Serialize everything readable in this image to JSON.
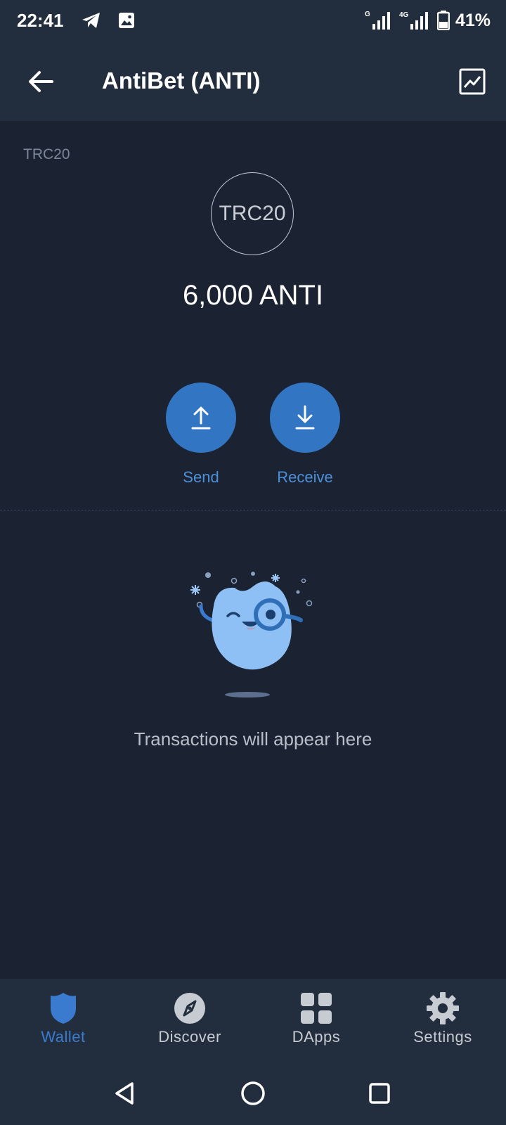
{
  "status_bar": {
    "time": "22:41",
    "battery": "41%",
    "left_icons": [
      "telegram-icon",
      "image-icon"
    ],
    "right_icons": [
      "signal-g-icon",
      "signal-4g-icon",
      "battery-icon"
    ],
    "network_labels": [
      "G",
      "4G"
    ]
  },
  "header": {
    "title": "AntiBet (ANTI)",
    "back_icon": "arrow-left-icon",
    "chart_icon": "price-chart-icon"
  },
  "token": {
    "network": "TRC20",
    "logo_text": "TRC20",
    "balance": "6,000 ANTI"
  },
  "actions": {
    "send_label": "Send",
    "receive_label": "Receive"
  },
  "transactions": {
    "empty_message": "Transactions will appear here"
  },
  "bottom_nav": {
    "items": [
      {
        "label": "Wallet",
        "icon": "shield-icon",
        "active": true
      },
      {
        "label": "Discover",
        "icon": "compass-icon",
        "active": false
      },
      {
        "label": "DApps",
        "icon": "grid-icon",
        "active": false
      },
      {
        "label": "Settings",
        "icon": "gear-icon",
        "active": false
      }
    ]
  },
  "colors": {
    "background": "#1b2333",
    "bar": "#222d3d",
    "accent": "#3276c3",
    "accent_text": "#4d8fd8"
  }
}
